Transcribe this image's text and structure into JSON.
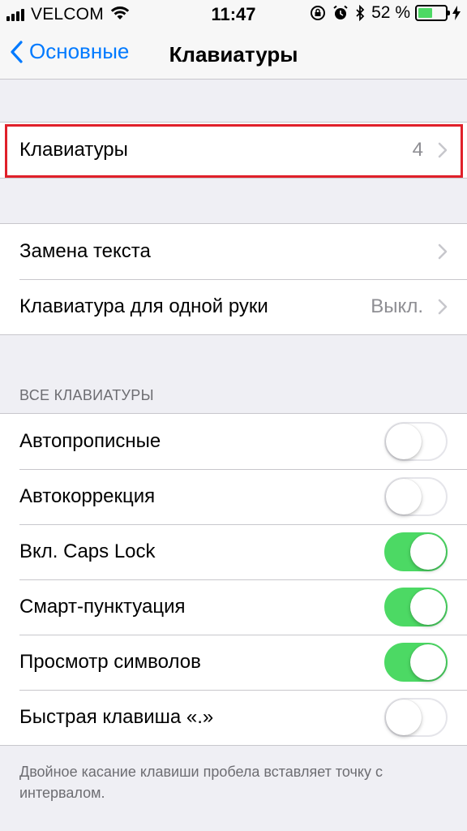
{
  "status_bar": {
    "carrier": "VELCOM",
    "time": "11:47",
    "battery_percent": "52 %",
    "battery_level": 0.52,
    "icons": [
      "signal-icon",
      "wifi-icon",
      "orientation-lock-icon",
      "alarm-icon",
      "bluetooth-icon",
      "battery-icon",
      "charging-icon"
    ]
  },
  "nav": {
    "back_label": "Основные",
    "title": "Клавиатуры"
  },
  "group1": {
    "keyboards": {
      "label": "Клавиатуры",
      "value": "4"
    }
  },
  "group2": {
    "text_replacement": {
      "label": "Замена текста"
    },
    "one_handed": {
      "label": "Клавиатура для одной руки",
      "value": "Выкл."
    }
  },
  "all_keyboards": {
    "header": "ВСЕ КЛАВИАТУРЫ",
    "items": [
      {
        "label": "Автопрописные",
        "on": false
      },
      {
        "label": "Автокоррекция",
        "on": false
      },
      {
        "label": "Вкл. Caps Lock",
        "on": true
      },
      {
        "label": "Смарт-пунктуация",
        "on": true
      },
      {
        "label": "Просмотр символов",
        "on": true
      },
      {
        "label": "Быстрая клавиша «.»",
        "on": false
      }
    ],
    "footer": "Двойное касание клавиши пробела вставляет точку с интервалом."
  },
  "colors": {
    "accent": "#007aff",
    "toggle_on": "#4cd964",
    "highlight": "#e0202a"
  }
}
